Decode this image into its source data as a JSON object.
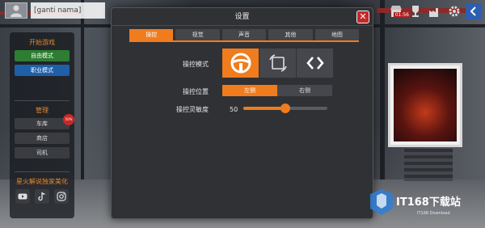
{
  "player": {
    "name": "[ganti nama]"
  },
  "top_bar": {
    "clock": "01:56",
    "icons": [
      "shop-icon",
      "trophy-icon",
      "factory-icon",
      "gear-icon",
      "back-arrow-icon"
    ]
  },
  "sidebar": {
    "start_game_title": "开始游戏",
    "free_mode": "自由模式",
    "career_mode": "职业模式",
    "manage_title": "管理",
    "garage": "车库",
    "garage_badge": "50%",
    "shop": "商店",
    "driver": "司机",
    "promo_text": "星火解说独家美化",
    "social": [
      "youtube-icon",
      "tiktok-icon",
      "instagram-icon"
    ]
  },
  "dialog": {
    "title": "设置",
    "tabs": [
      "操控",
      "视觉",
      "声音",
      "其他",
      "地图"
    ],
    "active_tab": 0,
    "control_mode_label": "操控模式",
    "control_modes": [
      "steering-wheel-icon",
      "tilt-icon",
      "arrows-icon"
    ],
    "active_mode": 0,
    "control_position_label": "操控位置",
    "positions": [
      "左侧",
      "右侧"
    ],
    "active_position": 0,
    "sensitivity_label": "操控灵敏度",
    "sensitivity_value": "50",
    "sensitivity_fraction": 0.5
  },
  "watermark": {
    "text": "IT168下载站",
    "sub": "IT168 Download"
  },
  "colors": {
    "accent": "#f07c1e",
    "close": "#c62828",
    "green": "#2e7d32",
    "blue": "#1f5fa8"
  }
}
